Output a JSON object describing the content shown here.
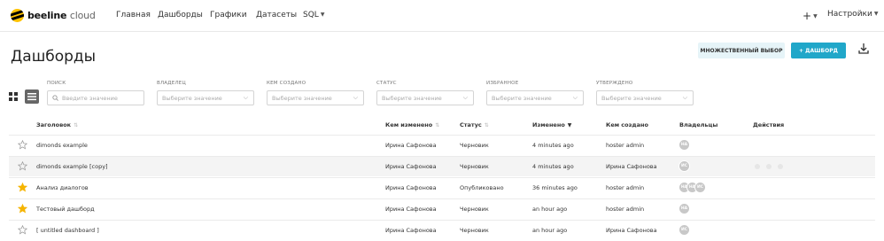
{
  "nav": {
    "logo_bold": "beeline",
    "logo_light": "cloud",
    "items": [
      {
        "label": "Главная"
      },
      {
        "label": "Дашборды"
      },
      {
        "label": "Графики"
      },
      {
        "label": "Датасеты"
      },
      {
        "label": "SQL"
      }
    ],
    "plus_label": "+",
    "settings_label": "Настройки"
  },
  "header": {
    "title": "Дашборды",
    "multi_select_label": "МНОЖЕСТВЕННЫЙ ВЫБОР",
    "add_dashboard_label": "+ ДАШБОРД"
  },
  "filters": [
    {
      "label": "ПОИСК",
      "placeholder": "Введите значение"
    },
    {
      "label": "ВЛАДЕЛЕЦ",
      "placeholder": "Выберите значение"
    },
    {
      "label": "КЕМ СОЗДАНО",
      "placeholder": "Выберите значение"
    },
    {
      "label": "СТАТУС",
      "placeholder": "Выберите значение"
    },
    {
      "label": "ИЗБРАННОЕ",
      "placeholder": "Выберите значение"
    },
    {
      "label": "УТВЕРЖДЕНО",
      "placeholder": "Выберите значение"
    }
  ],
  "table": {
    "columns": {
      "title": "Заголовок",
      "changed_by": "Кем изменено",
      "status": "Статус",
      "changed": "Изменено",
      "created_by": "Кем создано",
      "owners": "Владельцы",
      "actions": "Действия"
    },
    "rows": [
      {
        "favorite": false,
        "title": "dimonds example",
        "changed_by": "Ирина Сафонова",
        "status": "Черновик",
        "changed": "4 minutes ago",
        "created_by": "hoster admin",
        "owners": [
          "HA"
        ]
      },
      {
        "favorite": false,
        "title": "dimonds example [copy]",
        "changed_by": "Ирина Сафонова",
        "status": "Черновик",
        "changed": "4 minutes ago",
        "created_by": "Ирина Сафонова",
        "owners": [
          "ИС"
        ]
      },
      {
        "favorite": true,
        "title": "Анализ диалогов",
        "changed_by": "Ирина Сафонова",
        "status": "Опубликовано",
        "changed": "36 minutes ago",
        "created_by": "hoster admin",
        "owners": [
          "HA",
          "HA",
          "ИС"
        ]
      },
      {
        "favorite": true,
        "title": "Тестовый дашборд",
        "changed_by": "Ирина Сафонова",
        "status": "Черновик",
        "changed": "an hour ago",
        "created_by": "hoster admin",
        "owners": [
          "HA"
        ]
      },
      {
        "favorite": false,
        "title": "[ untitled dashboard ]",
        "changed_by": "Ирина Сафонова",
        "status": "Черновик",
        "changed": "an hour ago",
        "created_by": "Ирина Сафонова",
        "owners": [
          "ИС"
        ]
      }
    ]
  },
  "colors": {
    "accent": "#20a7c9",
    "accent_light": "#e6f4f8",
    "star_active": "#f5b400",
    "logo_yellow": "#ffc200"
  }
}
